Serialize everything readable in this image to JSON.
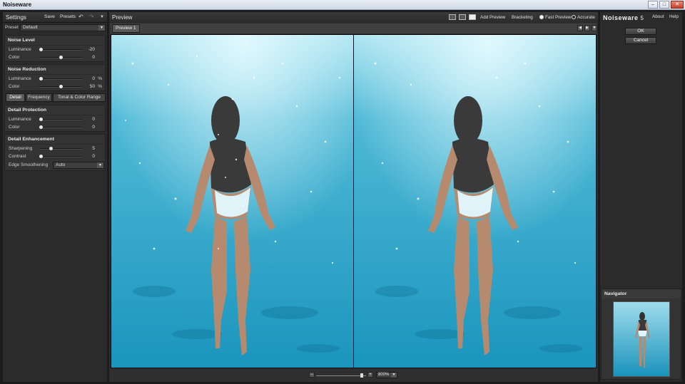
{
  "window": {
    "title": "Noiseware",
    "controls": [
      "–",
      "□",
      "✕"
    ]
  },
  "settings": {
    "title": "Settings",
    "save_label": "Save",
    "presets_label": "Presets",
    "undo_icon": "undo-icon",
    "redo_icon": "redo-icon",
    "menu_icon": "menu-icon",
    "preset_label": "Preset",
    "preset_value": "Default"
  },
  "noise_level": {
    "title": "Noise Level",
    "luminance": {
      "label": "Luminance",
      "value": "-20",
      "unit": "",
      "level": 0.0
    },
    "color": {
      "label": "Color",
      "value": "0",
      "unit": "",
      "level": 0.5
    }
  },
  "noise_reduction": {
    "title": "Noise Reduction",
    "luminance": {
      "label": "Luminance",
      "value": "0",
      "unit": "%",
      "level": 0.0
    },
    "color": {
      "label": "Color",
      "value": "50",
      "unit": "%",
      "level": 0.5
    }
  },
  "detail_tabs": {
    "detail": "Detail",
    "frequency": "Frequency",
    "tonal": "Tonal & Color Range"
  },
  "detail_protection": {
    "title": "Detail Protection",
    "luminance": {
      "label": "Luminance",
      "value": "0",
      "level": 0.0
    },
    "color": {
      "label": "Color",
      "value": "0",
      "level": 0.0
    }
  },
  "detail_enhancement": {
    "title": "Detail Enhancement",
    "sharpening": {
      "label": "Sharpening",
      "value": "5",
      "level": 0.25
    },
    "contrast": {
      "label": "Contrast",
      "value": "0",
      "level": 0.0
    },
    "edge_smoothening": {
      "label": "Edge Smoothening",
      "value": "Auto"
    }
  },
  "preview": {
    "title": "Preview",
    "add_preview": "Add Preview",
    "bracketing": "Bracketing",
    "fast_preview": "Fast Preview",
    "accurate": "Accurate",
    "tab": "Preview 1",
    "zoom": "800%",
    "zoom_level": 0.85
  },
  "brand": {
    "name": "Noiseware",
    "version": "5",
    "about": "About",
    "help": "Help"
  },
  "actions": {
    "ok": "OK",
    "cancel": "Cancel"
  },
  "navigator": {
    "title": "Navigator"
  },
  "colors": {
    "water_light": "#7fd3e6",
    "water_mid": "#2fa8cc",
    "water_deep": "#158bb3",
    "panel": "#2b2b2b",
    "background": "#1c1c1c"
  }
}
